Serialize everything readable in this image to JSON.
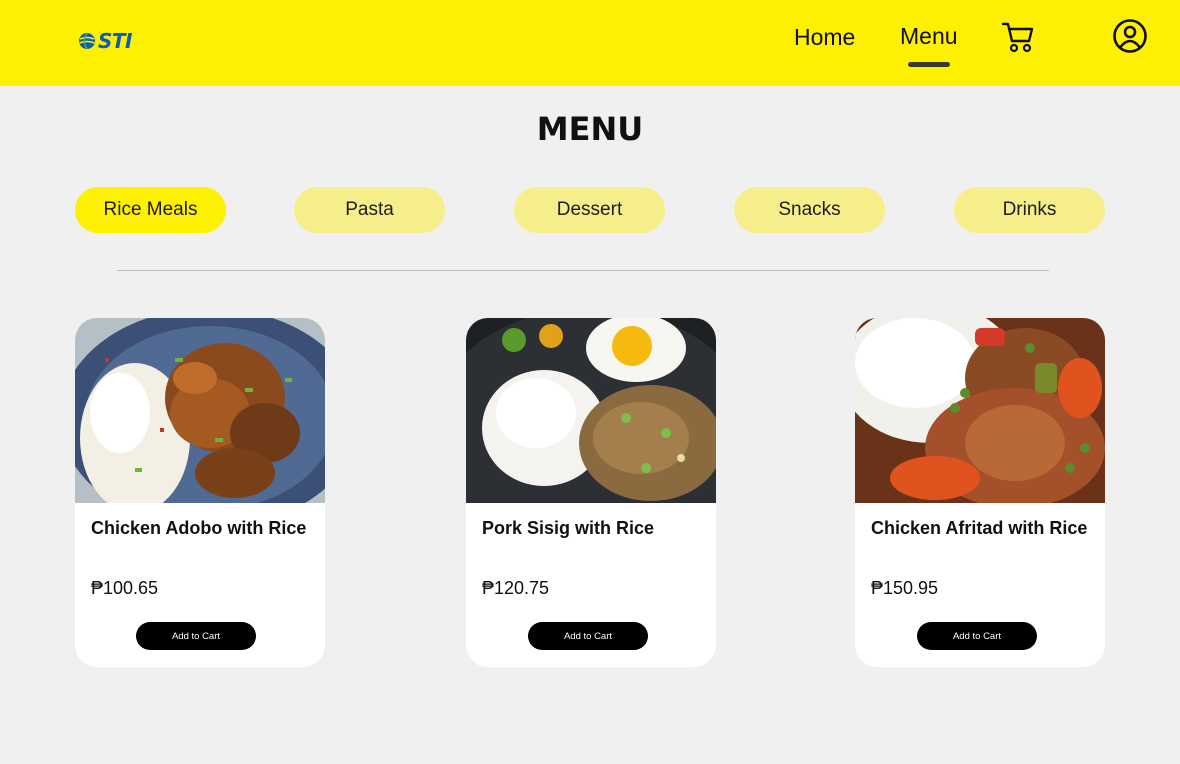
{
  "brand": {
    "logo_text": "STI",
    "colors": {
      "logo_blue": "#0b5fb0",
      "logo_green": "#55b046"
    }
  },
  "header": {
    "background": "#fdf001",
    "nav": [
      {
        "label": "Home",
        "active": false
      },
      {
        "label": "Menu",
        "active": true
      }
    ],
    "cart_icon": "cart-icon",
    "profile_icon": "user-circle-icon"
  },
  "page": {
    "title": "MENU"
  },
  "categories": [
    {
      "label": "Rice Meals",
      "active": true
    },
    {
      "label": "Pasta",
      "active": false
    },
    {
      "label": "Dessert",
      "active": false
    },
    {
      "label": "Snacks",
      "active": false
    },
    {
      "label": "Drinks",
      "active": false
    }
  ],
  "products": [
    {
      "name": "Chicken Adobo with Rice",
      "price": "₱100.65",
      "button": "Add to Cart"
    },
    {
      "name": "Pork Sisig with Rice",
      "price": "₱120.75",
      "button": "Add to Cart"
    },
    {
      "name": "Chicken Afritad with Rice",
      "price": "₱150.95",
      "button": "Add to Cart"
    }
  ],
  "colors": {
    "accent": "#fdf001",
    "chip_inactive": "#f6ee8a",
    "button": "#000000"
  }
}
